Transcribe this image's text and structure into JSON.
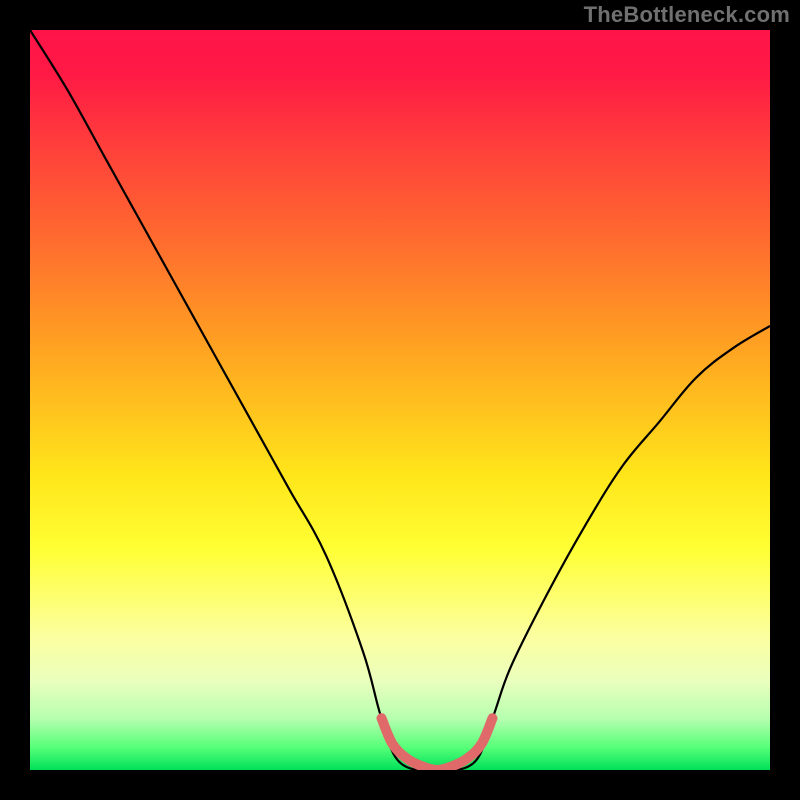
{
  "watermark": "TheBottleneck.com",
  "chart_data": {
    "type": "line",
    "title": "",
    "xlabel": "",
    "ylabel": "",
    "xlim": [
      0,
      1
    ],
    "ylim": [
      0,
      1
    ],
    "series": [
      {
        "name": "bottleneck-curve",
        "color": "#000000",
        "x": [
          0.0,
          0.05,
          0.1,
          0.15,
          0.2,
          0.25,
          0.3,
          0.35,
          0.4,
          0.45,
          0.475,
          0.5,
          0.55,
          0.6,
          0.625,
          0.65,
          0.7,
          0.75,
          0.8,
          0.85,
          0.9,
          0.95,
          1.0
        ],
        "y": [
          1.0,
          0.92,
          0.83,
          0.74,
          0.65,
          0.56,
          0.47,
          0.38,
          0.29,
          0.16,
          0.07,
          0.01,
          0.0,
          0.01,
          0.07,
          0.14,
          0.24,
          0.33,
          0.41,
          0.47,
          0.53,
          0.57,
          0.6
        ]
      },
      {
        "name": "optimal-range-highlight",
        "color": "#e36a6a",
        "x": [
          0.475,
          0.49,
          0.51,
          0.53,
          0.55,
          0.57,
          0.59,
          0.61,
          0.625
        ],
        "y": [
          0.07,
          0.035,
          0.015,
          0.005,
          0.0,
          0.005,
          0.015,
          0.035,
          0.07
        ]
      }
    ],
    "background_gradient_stops": [
      {
        "pos": 0.0,
        "color": "#ff1449"
      },
      {
        "pos": 0.6,
        "color": "#ffe51a"
      },
      {
        "pos": 0.88,
        "color": "#eaffbd"
      },
      {
        "pos": 1.0,
        "color": "#00e05a"
      }
    ]
  }
}
